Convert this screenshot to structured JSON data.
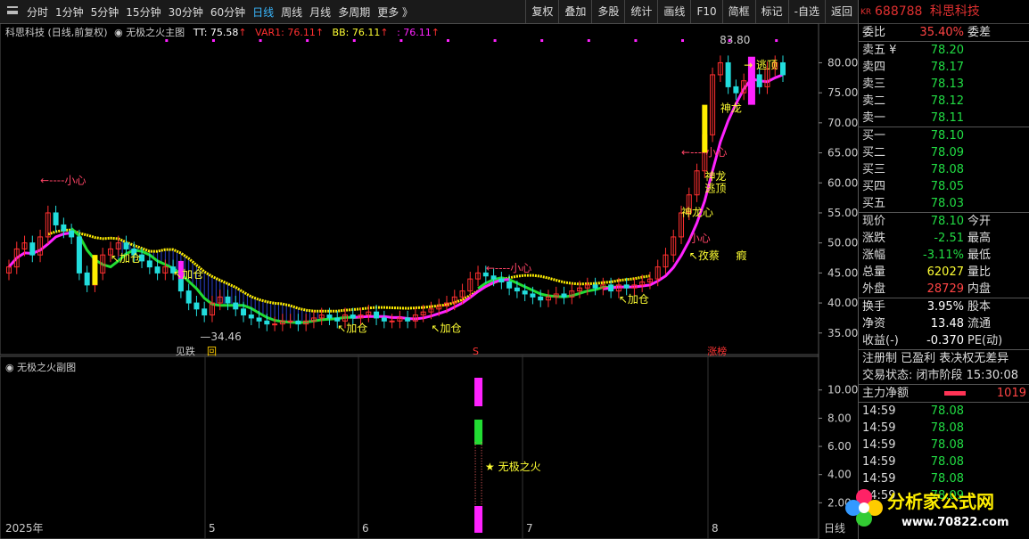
{
  "toolbar": {
    "periods": [
      "分时",
      "1分钟",
      "5分钟",
      "15分钟",
      "30分钟",
      "60分钟",
      "日线",
      "周线",
      "月线",
      "多周期",
      "更多 》"
    ],
    "active_period": "日线",
    "tools": [
      "复权",
      "叠加",
      "多股",
      "统计",
      "画线",
      "F10",
      "简框",
      "标记",
      "-自选",
      "返回"
    ]
  },
  "legend": {
    "stock": "科思科技 (日线,前复权)",
    "indicator": "无极之火主图",
    "tt_label": "TT: 75.58",
    "var1_label": "VAR1: 76.11",
    "bb_label": "BB: 76.11",
    "extra_label": ": 76.11",
    "sub_indicator": "无极之火副图",
    "sub_star": "★ 无极之火"
  },
  "chart_data": {
    "type": "candlestick",
    "y_ticks": [
      "80.00",
      "75.00",
      "70.00",
      "65.00",
      "60.00",
      "55.00",
      "50.00",
      "45.00",
      "40.00",
      "35.00"
    ],
    "ylim": [
      32,
      86
    ],
    "x_ticks": [
      "2025年",
      "5",
      "6",
      "7",
      "8",
      "日线"
    ],
    "sub_y_ticks": [
      "10.00",
      "8.00",
      "6.00",
      "4.00",
      "2.00"
    ],
    "high_label": "83.80",
    "low_label": "34.46",
    "annotations": [
      {
        "text": "←----小心",
        "i": 4,
        "price": 59.8,
        "color": "#ff4466"
      },
      {
        "text": "↖加仓",
        "i": 13,
        "price": 46.8,
        "color": "#ffff33"
      },
      {
        "text": "↖加仓",
        "i": 21,
        "price": 44.2,
        "color": "#ffff33"
      },
      {
        "text": "↖加仓",
        "i": 42,
        "price": 35.2,
        "color": "#ffff33"
      },
      {
        "text": "↖加仓",
        "i": 54,
        "price": 35.2,
        "color": "#ffff33"
      },
      {
        "text": "←----小心",
        "i": 61,
        "price": 45.2,
        "color": "#ff4466"
      },
      {
        "text": "↖加仓",
        "i": 78,
        "price": 40.0,
        "color": "#ffff33"
      },
      {
        "text": "↖孜蔡",
        "i": 87,
        "price": 47.3,
        "color": "#ffff33"
      },
      {
        "text": "瘕",
        "i": 93,
        "price": 47.3,
        "color": "#ffff33"
      },
      {
        "text": "小心",
        "i": 87,
        "price": 50.2,
        "color": "#ff4466"
      },
      {
        "text": "神龙心",
        "i": 86,
        "price": 54.5,
        "color": "#ffff33"
      },
      {
        "text": "逃顶",
        "i": 89,
        "price": 58.5,
        "color": "#ffff33"
      },
      {
        "text": "神龙",
        "i": 89,
        "price": 60.5,
        "color": "#ffff33"
      },
      {
        "text": "←----小心",
        "i": 86,
        "price": 64.5,
        "color": "#ff4466"
      },
      {
        "text": "神龙",
        "i": 91,
        "price": 71.8,
        "color": "#ffff33"
      },
      {
        "text": "→ 逃顶",
        "i": 94,
        "price": 79.0,
        "color": "#ffff33"
      }
    ],
    "bottom_marks": [
      {
        "text": "见跌",
        "i": 22,
        "color": "#ccc"
      },
      {
        "text": "回",
        "i": 26,
        "color": "#ffcc00"
      },
      {
        "text": "S",
        "i": 60,
        "color": "#ff3333"
      },
      {
        "text": "涨榜",
        "i": 90,
        "color": "#ff3333"
      }
    ],
    "closes": [
      46,
      49,
      50,
      48,
      51,
      55,
      53,
      52,
      51,
      45,
      43,
      45,
      48,
      49,
      50,
      49,
      48,
      47,
      46,
      45,
      46,
      45,
      42,
      40,
      39,
      38,
      40,
      41,
      40,
      39,
      38,
      37.5,
      37,
      36.5,
      36.5,
      37,
      37,
      36.5,
      37,
      37.5,
      38,
      37.5,
      37,
      38,
      37.5,
      38,
      38.5,
      37.5,
      37,
      37,
      37.5,
      37,
      38,
      38.5,
      39,
      39.5,
      40,
      41,
      42,
      44,
      45,
      44.5,
      44,
      43.5,
      42.5,
      42,
      41.5,
      41,
      40.5,
      41,
      41.5,
      41,
      42,
      42.5,
      43,
      42.5,
      43,
      42,
      43,
      42.5,
      43,
      43.5,
      44,
      46,
      48,
      51,
      55,
      58,
      62,
      68,
      78,
      80,
      76,
      75,
      77,
      78,
      76,
      79,
      80,
      78
    ]
  },
  "sub_chart": {
    "value_hint": "10.00"
  },
  "quote": {
    "code": "688788",
    "name": "科思科技",
    "kr": "KR",
    "weibi_label": "委比",
    "weibi": "35.40%",
    "weicha": "委差",
    "sells": [
      {
        "l": "卖五",
        "v": "78.20",
        "extra": "¥"
      },
      {
        "l": "卖四",
        "v": "78.17"
      },
      {
        "l": "卖三",
        "v": "78.13"
      },
      {
        "l": "卖二",
        "v": "78.12"
      },
      {
        "l": "卖一",
        "v": "78.11"
      }
    ],
    "buys": [
      {
        "l": "买一",
        "v": "78.10"
      },
      {
        "l": "买二",
        "v": "78.09"
      },
      {
        "l": "买三",
        "v": "78.08"
      },
      {
        "l": "买四",
        "v": "78.05"
      },
      {
        "l": "买五",
        "v": "78.03"
      }
    ],
    "stats": [
      {
        "l": "现价",
        "v": "78.10",
        "r": "今开",
        "c": "green"
      },
      {
        "l": "涨跌",
        "v": "-2.51",
        "r": "最高",
        "c": "green"
      },
      {
        "l": "涨幅",
        "v": "-3.11%",
        "r": "最低",
        "c": "green"
      },
      {
        "l": "总量",
        "v": "62027",
        "r": "量比",
        "c": "yellow"
      },
      {
        "l": "外盘",
        "v": "28729",
        "r": "内盘",
        "c": "red"
      }
    ],
    "stats2": [
      {
        "l": "换手",
        "v": "3.95%",
        "r": "股本"
      },
      {
        "l": "净资",
        "v": "13.48",
        "r": "流通"
      },
      {
        "l": "收益(-)",
        "v": "-0.370",
        "r": "PE(动)"
      }
    ],
    "tags": "注册制 已盈利 表决权无差异",
    "status": "交易状态: 闭市阶段 15:30:08",
    "main_flow_label": "主力净额",
    "main_flow_value": "1019",
    "ticks": [
      {
        "t": "14:59",
        "v": "78.08"
      },
      {
        "t": "14:59",
        "v": "78.08"
      },
      {
        "t": "14:59",
        "v": "78.08"
      },
      {
        "t": "14:59",
        "v": "78.08"
      },
      {
        "t": "14:59",
        "v": "78.08"
      },
      {
        "t": "14:59",
        "v": "78.09"
      }
    ]
  },
  "watermark": {
    "text": "分析家公式网",
    "url": "www.70822.com"
  },
  "colors": {
    "up": "#ff3030",
    "down": "#22dddd",
    "magenta": "#ff22ff",
    "yellow": "#ffee00",
    "green": "#22dd33"
  }
}
